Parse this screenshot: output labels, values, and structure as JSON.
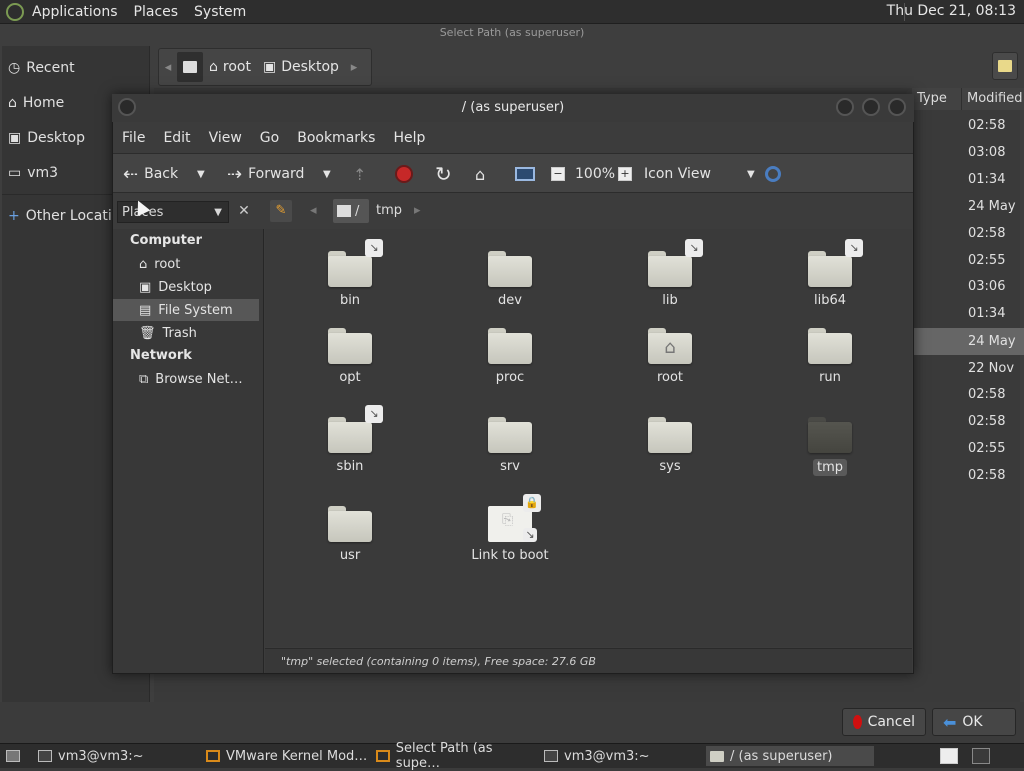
{
  "top_panel": {
    "menus": [
      "Applications",
      "Places",
      "System"
    ],
    "clock": "Thu Dec 21, 08:13"
  },
  "bg_dialog": {
    "title": "Select Path (as superuser)",
    "sidebar": [
      "Recent",
      "Home",
      "Desktop",
      "vm3",
      "Other Locations"
    ],
    "path": [
      "root",
      "Desktop"
    ],
    "columns": [
      "Type",
      "Modified"
    ],
    "times": [
      "02:58",
      "03:08",
      "01:34",
      "24 May",
      "02:58",
      "02:55",
      "03:06",
      "01:34",
      "24 May",
      "22 Nov",
      "02:58",
      "02:58",
      "02:55",
      "02:58"
    ],
    "cancel_label": "Cancel",
    "ok_label": "OK"
  },
  "window": {
    "title": "/ (as superuser)",
    "menu": [
      "File",
      "Edit",
      "View",
      "Go",
      "Bookmarks",
      "Help"
    ],
    "toolbar": {
      "back": "Back",
      "forward": "Forward",
      "zoom": "100%",
      "view_mode": "Icon View"
    },
    "places_combo": "Places",
    "location": [
      "/",
      "tmp"
    ],
    "left_pane": {
      "computer_heading": "Computer",
      "computer_items": [
        "root",
        "Desktop",
        "File System",
        "Trash"
      ],
      "network_heading": "Network",
      "network_items": [
        "Browse Net…"
      ]
    },
    "files": [
      "bin",
      "dev",
      "lib",
      "lib64",
      "opt",
      "proc",
      "root",
      "run",
      "sbin",
      "srv",
      "sys",
      "tmp",
      "usr",
      "Link to boot"
    ],
    "status": "\"tmp\" selected (containing 0 items), Free space: 27.6 GB"
  },
  "taskbar": {
    "items": [
      "vm3@vm3:~",
      "VMware Kernel Mod…",
      "Select Path (as supe…",
      "vm3@vm3:~",
      "/ (as superuser)"
    ]
  },
  "colors": {
    "selection": "#575757",
    "stop": "#c62828",
    "cancel_icon": "#d01010",
    "ok_icon": "#4a90d9"
  }
}
